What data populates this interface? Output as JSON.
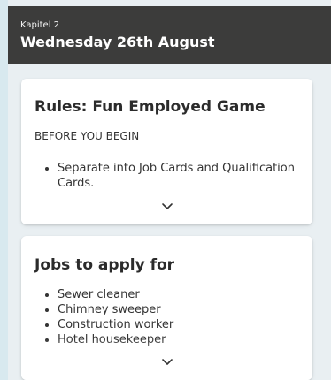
{
  "header": {
    "kicker": "Kapitel 2",
    "title": "Wednesday 26th August"
  },
  "cards": [
    {
      "title": "Rules: Fun Employed Game",
      "subtitle": "BEFORE YOU BEGIN",
      "items": [
        "Separate into Job Cards and Qualification Cards."
      ],
      "expand_icon": "chevron-down-icon"
    },
    {
      "title": "Jobs to apply for",
      "items": [
        "Sewer cleaner",
        "Chimney sweeper",
        "Construction worker",
        "Hotel housekeeper"
      ],
      "expand_icon": "chevron-down-icon"
    }
  ],
  "colors": {
    "header_bg": "#3c3c3b",
    "page_bg": "#e9eff2",
    "card_bg": "#ffffff"
  }
}
